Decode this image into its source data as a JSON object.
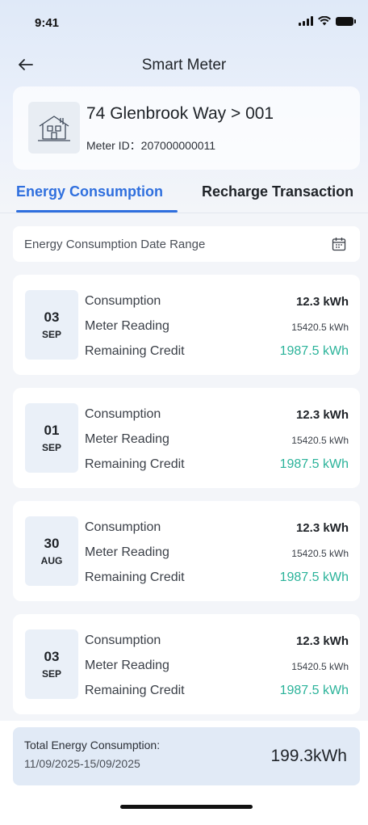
{
  "status_bar": {
    "time": "9:41"
  },
  "nav": {
    "title": "Smart Meter",
    "back_icon": "arrow-left"
  },
  "meter": {
    "name": "74 Glenbrook Way > 001",
    "id_label": "Meter ID：207000000011",
    "icon": "house-icon"
  },
  "tabs": [
    {
      "label": "Energy Consumption",
      "active": true
    },
    {
      "label": "Recharge Transaction",
      "active": false
    }
  ],
  "date_range": {
    "label": "Energy Consumption Date Range",
    "icon": "calendar-icon"
  },
  "labels": {
    "consumption": "Consumption",
    "meter_reading": "Meter Reading",
    "remaining_credit": "Remaining Credit"
  },
  "records": [
    {
      "day": "03",
      "month": "SEP",
      "consumption": "12.3 kWh",
      "meter_reading": "15420.5 kWh",
      "remaining_credit": "1987.5 kWh"
    },
    {
      "day": "01",
      "month": "SEP",
      "consumption": "12.3 kWh",
      "meter_reading": "15420.5 kWh",
      "remaining_credit": "1987.5 kWh"
    },
    {
      "day": "30",
      "month": "AUG",
      "consumption": "12.3 kWh",
      "meter_reading": "15420.5 kWh",
      "remaining_credit": "1987.5 kWh"
    },
    {
      "day": "03",
      "month": "SEP",
      "consumption": "12.3 kWh",
      "meter_reading": "15420.5 kWh",
      "remaining_credit": "1987.5 kWh"
    }
  ],
  "total": {
    "label": "Total Energy Consumption:",
    "range": "11/09/2025-15/09/2025",
    "value": "199.3kWh"
  },
  "colors": {
    "accent": "#2f6fde",
    "credit_green": "#2bb39a",
    "total_bar": "#e1eaf6"
  }
}
